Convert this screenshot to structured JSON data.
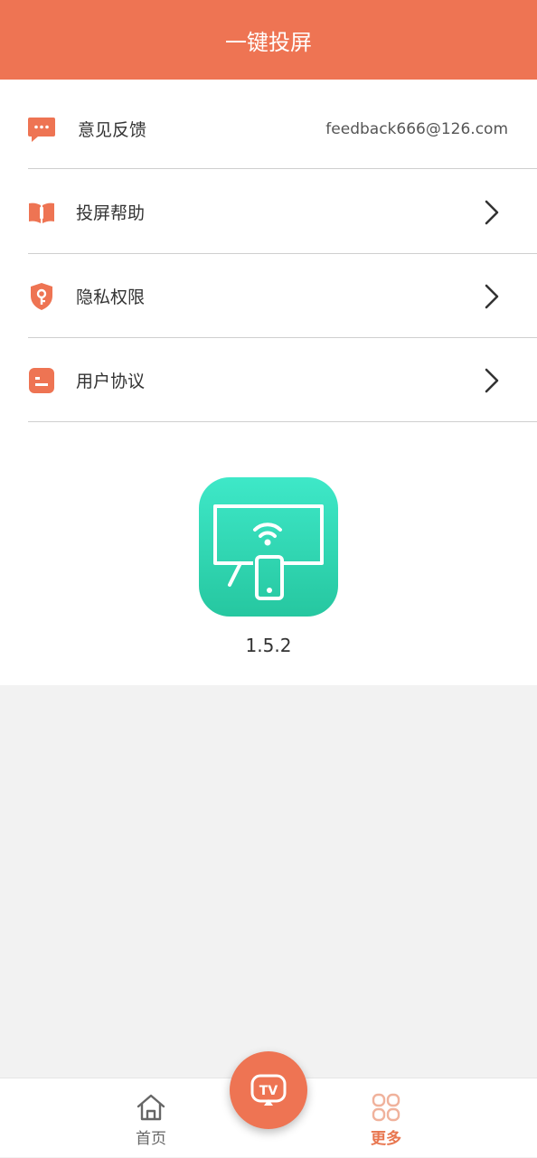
{
  "header": {
    "title": "一键投屏"
  },
  "menu": {
    "items": [
      {
        "label": "意见反馈",
        "value": "feedback666@126.com",
        "icon": "chat-bubble-icon"
      },
      {
        "label": "投屏帮助",
        "icon": "book-icon"
      },
      {
        "label": "隐私权限",
        "icon": "shield-key-icon"
      },
      {
        "label": "用户协议",
        "icon": "document-icon"
      }
    ]
  },
  "app": {
    "version": "1.5.2",
    "logo_icon": "screen-cast-icon"
  },
  "tabbar": {
    "tabs": [
      {
        "label": "首页",
        "icon": "home-icon",
        "active": false
      },
      {
        "label": "更多",
        "icon": "grid-icon",
        "active": true
      }
    ],
    "center_button": {
      "icon": "tv-cast-icon",
      "text": "TV"
    }
  },
  "colors": {
    "accent": "#ee7453",
    "logo_gradient_top": "#3ee8c8",
    "logo_gradient_bottom": "#26c7a0",
    "active_tab": "#e8764f",
    "inactive_tab": "#666666"
  }
}
